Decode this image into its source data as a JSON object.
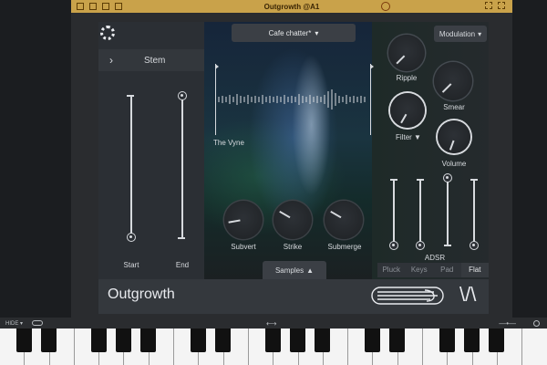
{
  "window": {
    "title": "Outgrowth @A1"
  },
  "plugin": {
    "preset": "Cafe chatter*",
    "modulation_label": "Modulation",
    "stem_label": "Stem",
    "start_label": "Start",
    "end_label": "End",
    "sample_name": "The Vyne",
    "knobs_top": [
      "Ripple",
      "Smear",
      "Filter",
      "Volume"
    ],
    "filter_caret": "▼",
    "knobs_bottom": [
      "Subvert",
      "Strike",
      "Submerge"
    ],
    "samples_label": "Samples",
    "samples_caret": "▲",
    "adsr_label": "ADSR",
    "adsr_modes": [
      "Pluck",
      "Keys",
      "Pad",
      "Flat"
    ],
    "adsr_active": "Flat",
    "brand": "Outgrowth",
    "vendor_mark": "\\/\\"
  },
  "host": {
    "hide_label": "HIDE",
    "scroll_label": "⟷"
  },
  "icons": [
    "gear-icon",
    "chevron-right-icon",
    "chevron-down-icon",
    "power-icon"
  ],
  "colors": {
    "accent": "#c9a24a",
    "panel": "#2b2f34",
    "text": "#d7dade"
  }
}
